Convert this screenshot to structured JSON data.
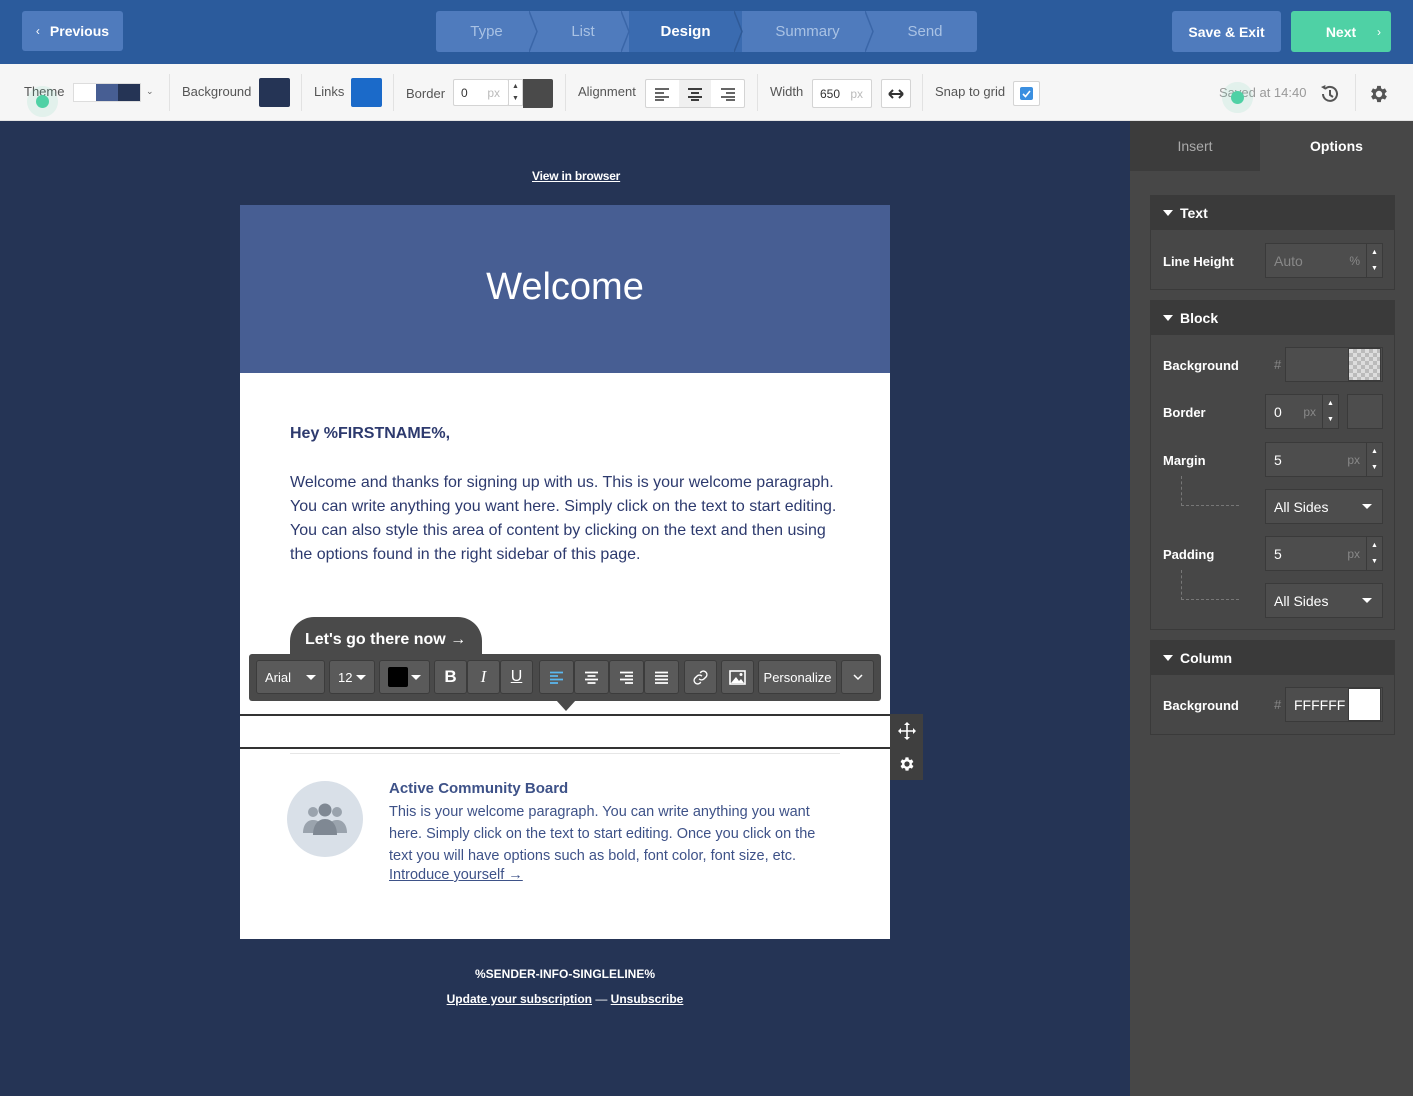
{
  "nav": {
    "previous_label": "Previous",
    "steps": [
      {
        "label": "Type"
      },
      {
        "label": "List"
      },
      {
        "label": "Design"
      },
      {
        "label": "Summary"
      },
      {
        "label": "Send"
      }
    ],
    "active_step": "Design",
    "save_exit_label": "Save & Exit",
    "next_label": "Next"
  },
  "toolbar": {
    "theme_label": "Theme",
    "theme_swatches": [
      "#ffffff",
      "#475e93",
      "#253455"
    ],
    "background_label": "Background",
    "background_color": "#253455",
    "links_label": "Links",
    "links_color": "#1b6ac9",
    "border_label": "Border",
    "border_value": "0",
    "border_unit": "px",
    "border_color": "#4a4a4a",
    "alignment_label": "Alignment",
    "alignment_active": "center",
    "width_label": "Width",
    "width_value": "650",
    "width_unit": "px",
    "snap_label": "Snap to grid",
    "snap_checked": true,
    "saved_text": "Saved at 14:40"
  },
  "email": {
    "view_in_browser": "View in browser",
    "header_title": "Welcome",
    "greeting": "Hey %FIRSTNAME%,",
    "paragraph": "Welcome and thanks for signing up with us. This is your welcome paragraph. You can write anything you want here. Simply click on the text to start editing. You can also style this area of content by clicking on the text and then using the options found in the right sidebar of this page.",
    "cta_label": "Let's go there now →",
    "card_title": "Active Community Board",
    "card_text": "This is your welcome paragraph. You can write anything you want here. Simply click on the text to start editing. Once you click on the text you will have options such as bold, font color, font size, etc.",
    "card_link": "Introduce yourself →",
    "sender_info": "%SENDER-INFO-SINGLELINE%",
    "update_link": "Update your subscription",
    "footer_sep": " — ",
    "unsubscribe_link": "Unsubscribe"
  },
  "editor_toolbar": {
    "font": "Arial",
    "size": "12",
    "text_color": "#000000",
    "personalize_label": "Personalize"
  },
  "panel": {
    "tabs": [
      {
        "label": "Insert"
      },
      {
        "label": "Options"
      }
    ],
    "active_tab": "Options",
    "text_section": {
      "title": "Text",
      "line_height_label": "Line Height",
      "line_height_placeholder": "Auto",
      "line_height_unit": "%"
    },
    "block_section": {
      "title": "Block",
      "background_label": "Background",
      "background_value": "",
      "border_label": "Border",
      "border_value": "0",
      "border_unit": "px",
      "margin_label": "Margin",
      "margin_value": "5",
      "margin_unit": "px",
      "margin_sides": "All Sides",
      "padding_label": "Padding",
      "padding_value": "5",
      "padding_unit": "px",
      "padding_sides": "All Sides"
    },
    "column_section": {
      "title": "Column",
      "background_label": "Background",
      "background_value": "FFFFFF",
      "background_color": "#ffffff"
    }
  },
  "colors": {
    "topbar": "#2b5b9c",
    "accent_green": "#4fd1a5",
    "canvas": "#253455",
    "email_header": "#475e93",
    "text_navy": "#2d3a6e"
  }
}
